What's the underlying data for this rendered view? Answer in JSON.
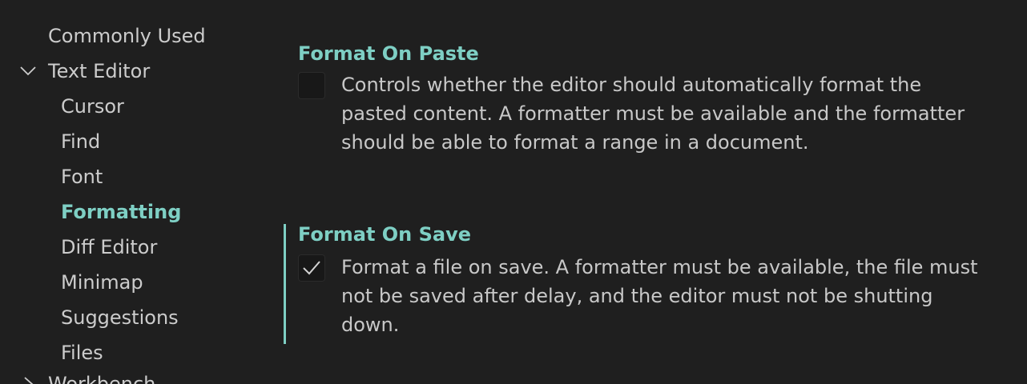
{
  "toc": {
    "items": [
      {
        "label": "Commonly Used"
      },
      {
        "label": "Text Editor"
      },
      {
        "label": "Cursor"
      },
      {
        "label": "Find"
      },
      {
        "label": "Font"
      },
      {
        "label": "Formatting"
      },
      {
        "label": "Diff Editor"
      },
      {
        "label": "Minimap"
      },
      {
        "label": "Suggestions"
      },
      {
        "label": "Files"
      },
      {
        "label": "Workbench"
      }
    ]
  },
  "settings": {
    "format_on_paste": {
      "title": "Format On Paste",
      "checked": false,
      "description_lines": [
        "Controls whether the editor should automatically format the",
        "pasted content. A formatter must be available and the formatter",
        "should be able to format a range in a document."
      ]
    },
    "format_on_save": {
      "title": "Format On Save",
      "checked": true,
      "description_lines": [
        "Format a file on save. A formatter must be available, the file must",
        "not be saved after delay, and the editor must not be shutting",
        "down."
      ]
    }
  },
  "colors": {
    "background": "#1f1f1f",
    "accent": "#7ecfc4",
    "text": "#cccccc"
  }
}
